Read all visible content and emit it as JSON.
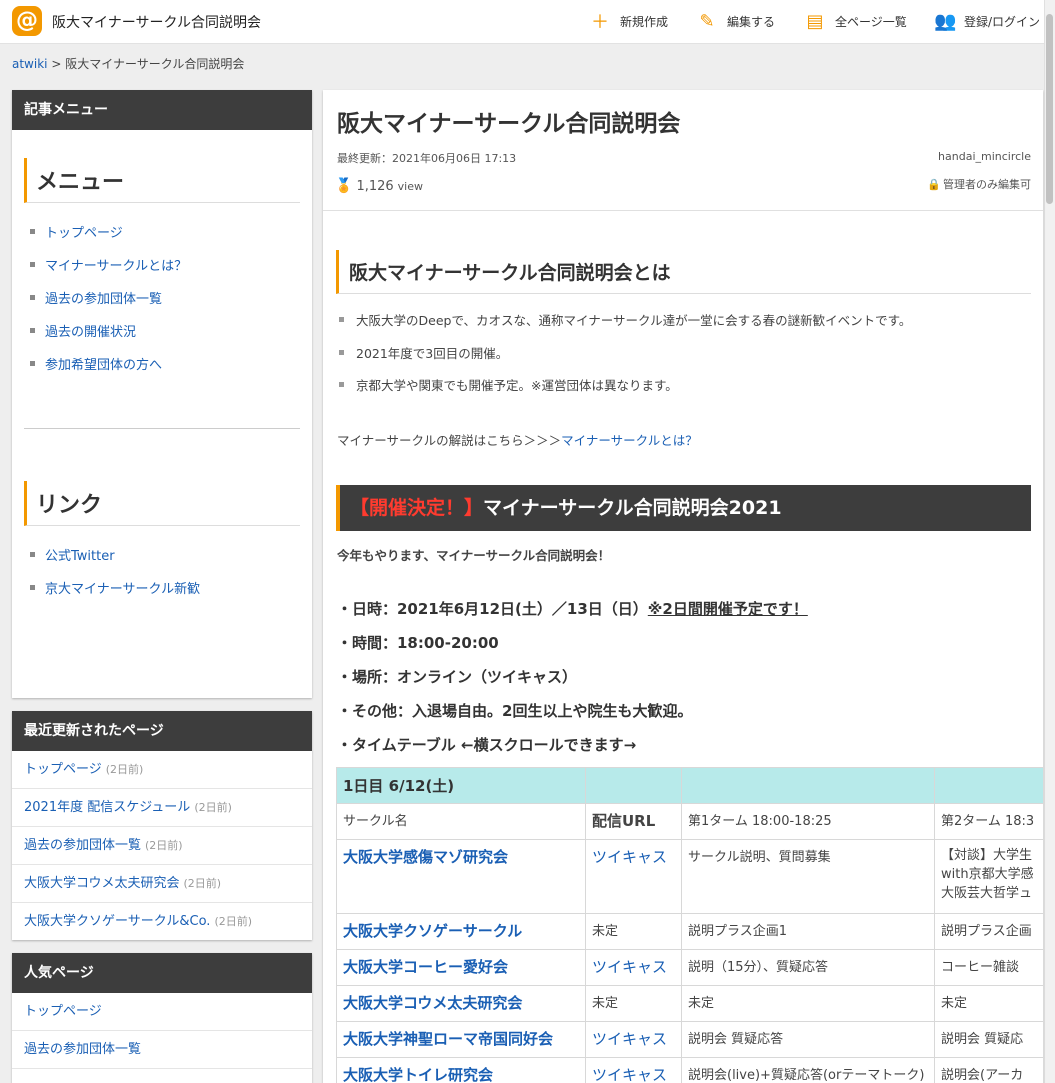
{
  "header": {
    "site_title": "阪大マイナーサークル合同説明会",
    "nav": [
      {
        "label": "新規作成",
        "icon": "plus-icon"
      },
      {
        "label": "編集する",
        "icon": "pencil-icon"
      },
      {
        "label": "全ページ一覧",
        "icon": "page-list-icon"
      },
      {
        "label": "登録/ログイン",
        "icon": "users-icon"
      }
    ]
  },
  "breadcrumb": {
    "root": "atwiki",
    "sep": ">",
    "current": "阪大マイナーサークル合同説明会"
  },
  "sidebar": {
    "menu_box_title": "記事メニュー",
    "menu_heading": "メニュー",
    "menu_items": [
      "トップページ",
      "マイナーサークルとは？",
      "過去の参加団体一覧",
      "過去の開催状況",
      "参加希望団体の方へ"
    ],
    "link_heading": "リンク",
    "link_items": [
      "公式Twitter",
      "京大マイナーサークル新歓"
    ],
    "recent_title": "最近更新されたページ",
    "recent_items": [
      {
        "label": "トップページ",
        "ago": "(2日前)"
      },
      {
        "label": "2021年度 配信スケジュール",
        "ago": "(2日前)"
      },
      {
        "label": "過去の参加団体一覧",
        "ago": "(2日前)"
      },
      {
        "label": "大阪大学コウメ太夫研究会",
        "ago": "(2日前)"
      },
      {
        "label": "大阪大学クソゲーサークル&Co.",
        "ago": "(2日前)"
      }
    ],
    "popular_title": "人気ページ",
    "popular_items": [
      "トップページ",
      "過去の参加団体一覧"
    ]
  },
  "main": {
    "title": "阪大マイナーサークル合同説明会",
    "updated": "最終更新：2021年06月06日 17:13",
    "author": "handai_mincircle",
    "views": "1,126",
    "views_unit": "view",
    "permission": "管理者のみ編集可",
    "section1": "阪大マイナーサークル合同説明会とは",
    "bullets": [
      "大阪大学のDeepで、カオスな、通称マイナーサークル達が一堂に会する春の謎新歓イベントです。",
      "2021年度で3回目の開催。",
      "京都大学や関東でも開催予定。※運営団体は異なります。"
    ],
    "explain_prefix": "マイナーサークルの解説はこちら＞＞＞",
    "explain_link": "マイナーサークルとは？",
    "event_head_red": "【開催決定！】",
    "event_head_rest": "マイナーサークル合同説明会2021",
    "intro": "今年もやります、マイナーサークル合同説明会！",
    "date_line": "・日時：2021年6月12日(土）／13日（日）",
    "date_note": "※2日間開催予定です！",
    "time_line": "・時間：18:00-20:00",
    "place_line": "・場所：オンライン（ツイキャス）",
    "other_line": "・その他：入退場自由。2回生以上や院生も大歓迎。",
    "timetable_line": "・タイムテーブル ←横スクロールできます→"
  },
  "table": {
    "day": "1日目 6/12(土)",
    "headers": [
      "サークル名",
      "配信URL",
      "第1ターム 18:00-18:25",
      "第2ターム 18:3"
    ],
    "rows": [
      {
        "name": "大阪大学感傷マゾ研究会",
        "url": "ツイキャス",
        "t1": "サークル説明、質問募集",
        "t2": [
          "【対談】大学生",
          "with京都大学感",
          "大阪芸大哲学ュ"
        ]
      },
      {
        "name": "大阪大学クソゲーサークル",
        "url": "未定",
        "t1": "説明プラス企画1",
        "t2": [
          "説明プラス企画"
        ]
      },
      {
        "name": "大阪大学コーヒー愛好会",
        "url": "ツイキャス",
        "t1": "説明（15分）、質疑応答",
        "t2": [
          "コーヒー雑談"
        ]
      },
      {
        "name": "大阪大学コウメ太夫研究会",
        "url": "未定",
        "t1": "未定",
        "t2": [
          "未定"
        ]
      },
      {
        "name": "大阪大学神聖ローマ帝国同好会",
        "url": "ツイキャス",
        "t1": "説明会 質疑応答",
        "t2": [
          "説明会 質疑応"
        ]
      },
      {
        "name": "大阪大学トイレ研究会",
        "url": "ツイキャス",
        "t1": "説明会(live)+質疑応答(orテーマトーク)",
        "t2": [
          "説明会(アーカ"
        ]
      }
    ]
  }
}
